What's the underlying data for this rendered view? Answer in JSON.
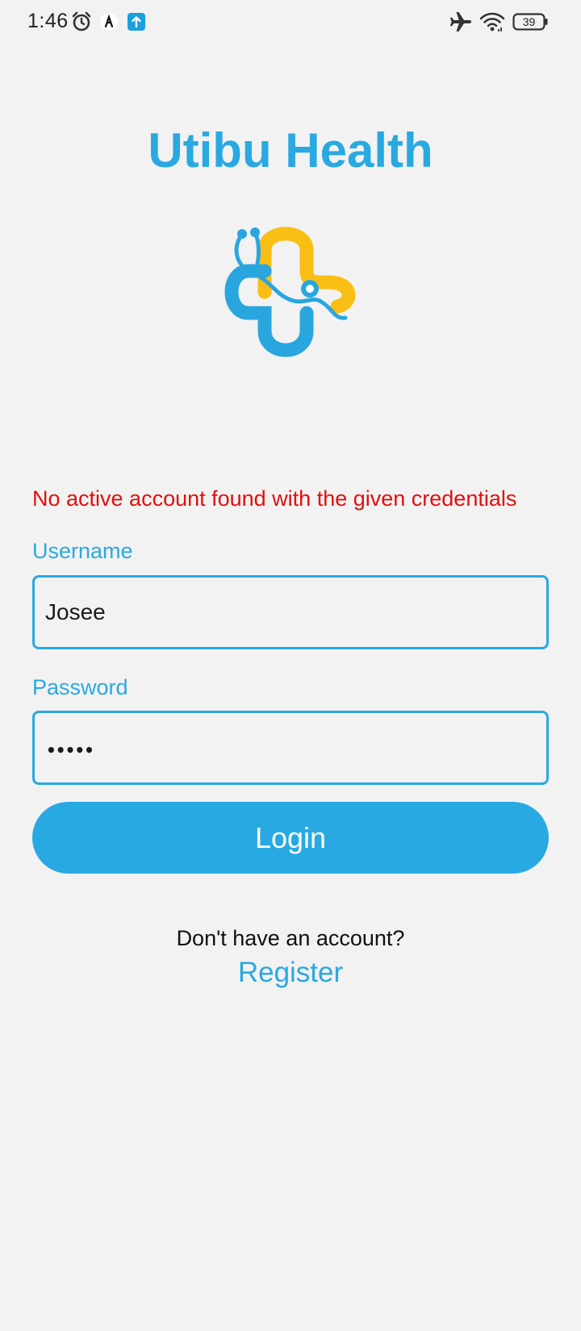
{
  "status_bar": {
    "time": "1:46",
    "battery": "39",
    "icons": [
      "alarm-icon",
      "notification-app-icon",
      "upload-icon",
      "airplane-mode-icon",
      "wifi-icon",
      "battery-icon"
    ]
  },
  "app": {
    "title": "Utibu Health",
    "logo": "medical-cross-stethoscope-logo"
  },
  "login_form": {
    "error_message": "No active account found with the given credentials",
    "username_label": "Username",
    "username_value": "Josee",
    "password_label": "Password",
    "password_value": "•••••",
    "login_label": "Login"
  },
  "register": {
    "prompt": "Don't have an account?",
    "link_label": "Register"
  },
  "colors": {
    "accent": "#29a9e1",
    "logo_yellow": "#f9bf15",
    "error": "#e0100e",
    "background": "#f2f2f2"
  }
}
